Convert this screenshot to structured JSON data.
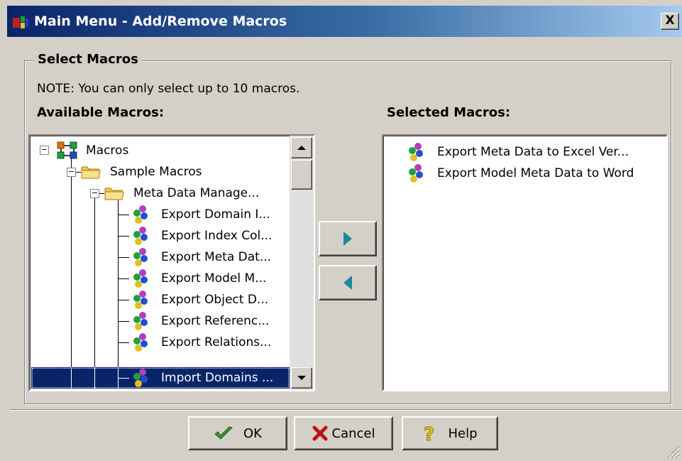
{
  "window": {
    "title": "Main Menu - Add/Remove Macros",
    "close_label": "X"
  },
  "group": {
    "title": "Select Macros",
    "note": "NOTE: You can only select up to 10 macros."
  },
  "available": {
    "label": "Available Macros:",
    "tree": {
      "root": "Macros",
      "folder1": "Sample Macros",
      "folder2": "Meta Data Manage...",
      "items": [
        "Export Domain I...",
        "Export Index Col...",
        "Export Meta Dat...",
        "Export Model M...",
        "Export Object D...",
        "Export Referenc...",
        "Export Relations...",
        "Import Domains ..."
      ],
      "selected_item": "Import Domains ..."
    }
  },
  "selected": {
    "label": "Selected Macros:",
    "items": [
      "Export Meta Data to Excel Ver...",
      "Export Model Meta Data to Word"
    ]
  },
  "buttons": {
    "ok": "OK",
    "cancel": "Cancel",
    "help": "Help"
  },
  "colors": {
    "title_bar_start": "#0a246a",
    "title_bar_end": "#a6caf0",
    "selection": "#0a246a",
    "arrow": "#1b8a9a",
    "dialog_bg": "#d4d0c8"
  },
  "icons": {
    "root": "macro-tree-icon",
    "folder": "folder-icon",
    "macro": "macro-icon",
    "add": "arrow-right-icon",
    "remove": "arrow-left-icon",
    "ok": "checkmark-icon",
    "cancel": "red-x-icon",
    "help": "question-mark-icon"
  }
}
